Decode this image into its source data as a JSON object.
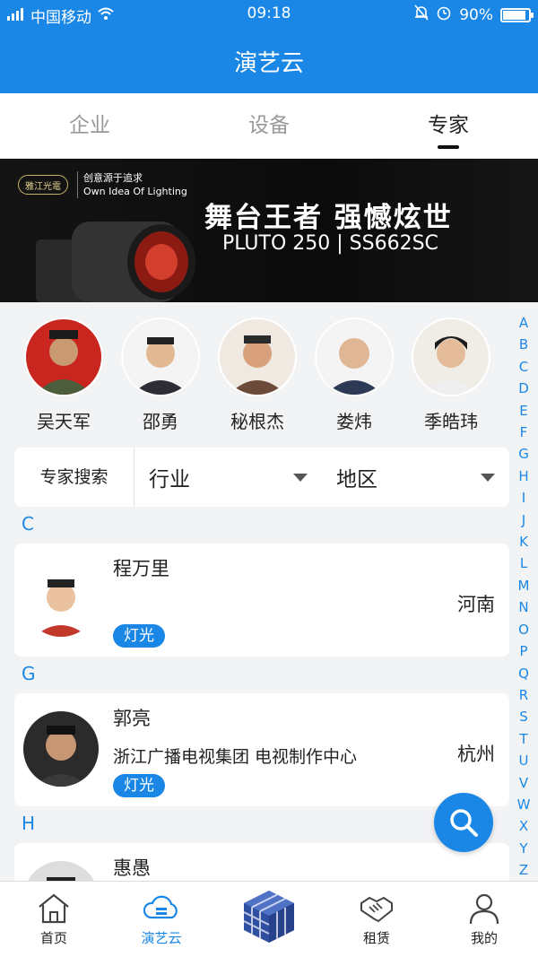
{
  "status": {
    "carrier": "中国移动",
    "time": "09:18",
    "battery": "90%",
    "battery_level": 0.9
  },
  "app_title": "演艺云",
  "tabs": [
    {
      "label": "企业"
    },
    {
      "label": "设备"
    },
    {
      "label": "专家"
    }
  ],
  "banner": {
    "brand_cn": "创意源于追求",
    "brand_en": "Own Idea Of Lighting",
    "headline": "舞台王者 强憾炫世",
    "model": "PLUTO 250 | SS662SC",
    "logo_text": "雅江光電"
  },
  "featured_experts": [
    {
      "name": "吴天军"
    },
    {
      "name": "邵勇"
    },
    {
      "name": "秘根杰"
    },
    {
      "name": "娄炜"
    },
    {
      "name": "季皓玮"
    }
  ],
  "filter": {
    "search_label": "专家搜索",
    "industry": "行业",
    "region": "地区"
  },
  "sections": [
    {
      "letter": "C",
      "cards": [
        {
          "name": "程万里",
          "org": "",
          "city": "河南",
          "tag": "灯光"
        }
      ]
    },
    {
      "letter": "G",
      "cards": [
        {
          "name": "郭亮",
          "org": "浙江广播电视集团 电视制作中心",
          "city": "杭州",
          "tag": "灯光"
        }
      ]
    },
    {
      "letter": "H",
      "cards": [
        {
          "name": "惠愚",
          "org": "",
          "city": "",
          "tag": ""
        }
      ]
    }
  ],
  "alpha_index": [
    "A",
    "B",
    "C",
    "D",
    "E",
    "F",
    "G",
    "H",
    "I",
    "J",
    "K",
    "L",
    "M",
    "N",
    "O",
    "P",
    "Q",
    "R",
    "S",
    "T",
    "U",
    "V",
    "W",
    "X",
    "Y",
    "Z"
  ],
  "bottom_nav": [
    {
      "label": "首页"
    },
    {
      "label": "演艺云"
    },
    {
      "label": ""
    },
    {
      "label": "租赁"
    },
    {
      "label": "我的"
    }
  ],
  "colors": {
    "primary": "#1a87e6",
    "background": "#f2f3f5"
  }
}
